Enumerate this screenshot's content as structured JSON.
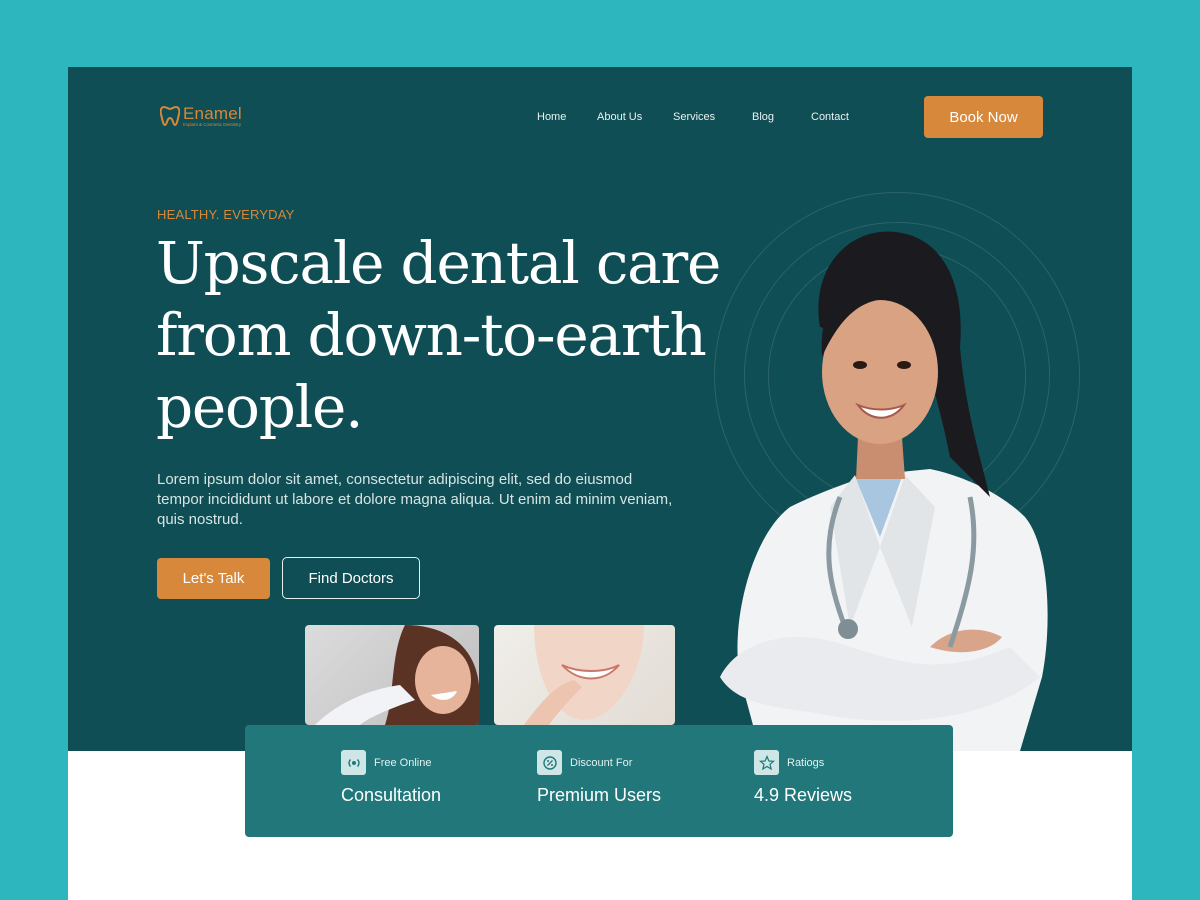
{
  "brand": {
    "name": "Enamel",
    "tagline": "Implant & Cosmetic Dentistry"
  },
  "nav": {
    "items": [
      "Home",
      "About Us",
      "Services",
      "Blog",
      "Contact"
    ],
    "book_label": "Book Now"
  },
  "hero": {
    "eyebrow": "HEALTHY. EVERYDAY",
    "headline_lines": [
      "Upscale dental care",
      "from down-to-earth",
      "people."
    ],
    "description": "Lorem ipsum dolor sit amet, consectetur adipiscing elit, sed do eiusmod tempor incididunt ut labore et dolore magna aliqua. Ut enim ad minim veniam, quis nostrud.",
    "primary_cta": "Let's Talk",
    "secondary_cta": "Find Doctors"
  },
  "stats": [
    {
      "icon": "broadcast-icon",
      "label": "Free Online",
      "value": "Consultation"
    },
    {
      "icon": "discount-icon",
      "label": "Discount For",
      "value": "Premium Users"
    },
    {
      "icon": "star-icon",
      "label": "Ratiogs",
      "value": "4.9 Reviews"
    }
  ],
  "colors": {
    "page_bg": "#2eb6bf",
    "hero_bg": "#0f4e54",
    "accent": "#d8883a",
    "stats_bg": "#21777a"
  }
}
